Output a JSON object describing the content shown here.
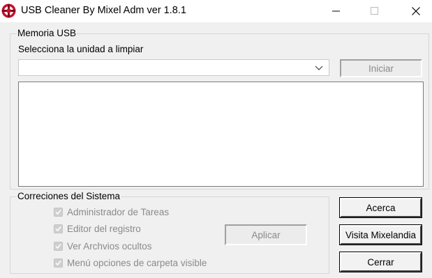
{
  "window": {
    "title": "USB Cleaner By Mixel Adm ver 1.8.1",
    "icon": "app-logo-icon",
    "controls": [
      "minimize-icon",
      "maximize-icon",
      "close-icon"
    ]
  },
  "usb_group": {
    "title": "Memoria USB",
    "select_label": "Selecciona la unidad a limpiar",
    "drive_value": "",
    "start_button": "Iniciar",
    "start_enabled": false,
    "log_text": ""
  },
  "system_group": {
    "title": "Correciones del Sistema",
    "options": [
      {
        "label": "Administrador de Tareas",
        "checked": true
      },
      {
        "label": "Editor del registro",
        "checked": true
      },
      {
        "label": "Ver Archvios ocultos",
        "checked": true
      },
      {
        "label": "Menú opciones de carpeta visible",
        "checked": true
      }
    ],
    "apply_button": "Aplicar",
    "apply_enabled": false
  },
  "side_buttons": {
    "about": "Acerca",
    "visit": "Visita Mixelandia",
    "close": "Cerrar"
  },
  "colors": {
    "logo_red": "#c8102e",
    "titlebar_bg": "#ffffff",
    "window_bg": "#f0f0f0",
    "disabled_text": "#8a8a8a"
  }
}
